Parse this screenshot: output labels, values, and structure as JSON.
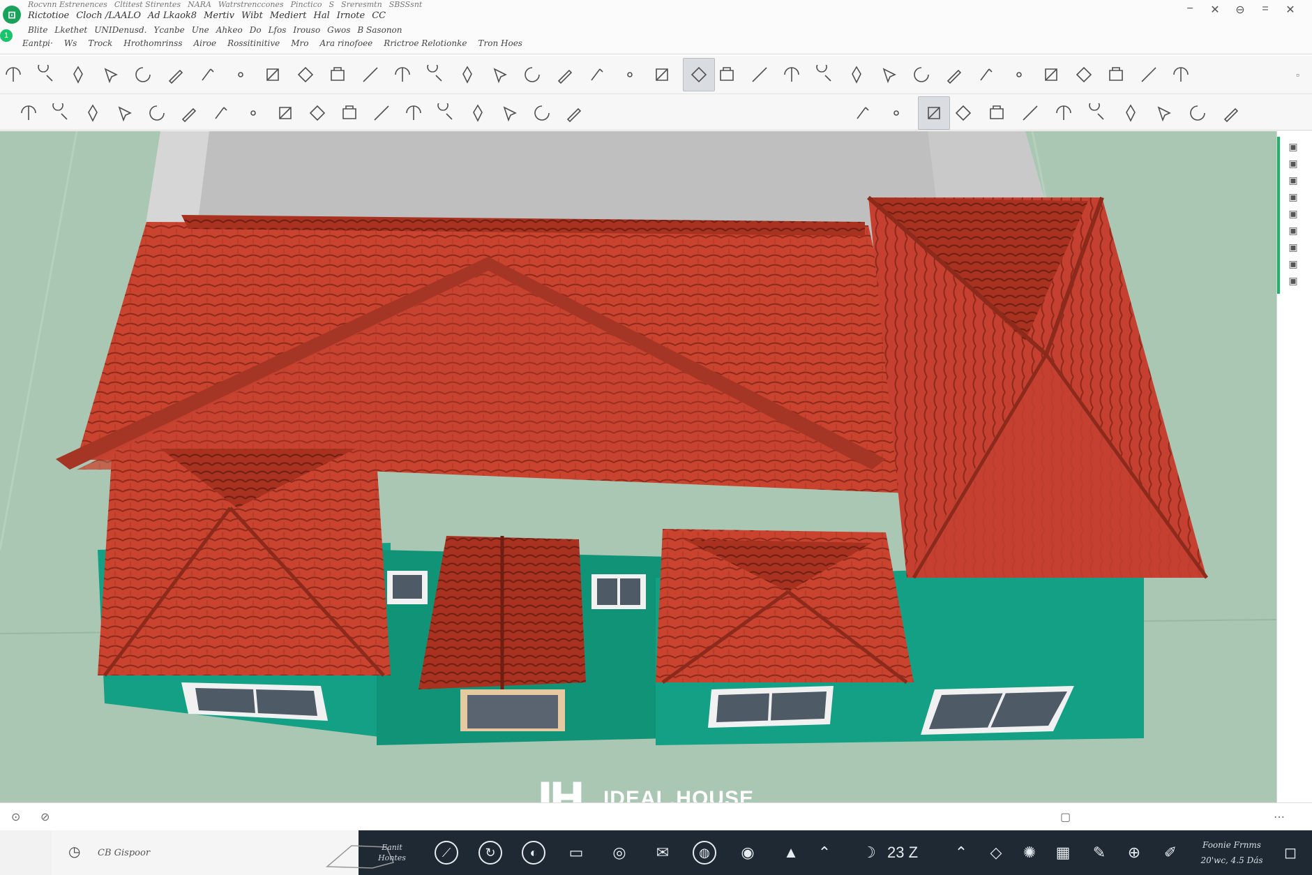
{
  "app": {
    "badge": "⊡",
    "badge2": "1"
  },
  "menus": {
    "row1": [
      "Rocvnn Estrenences",
      "Cltitest Stirentes",
      "NARA",
      "Watrstrenccones",
      "Pinctico",
      "S",
      "Sreresmtn",
      "SBSSsnt"
    ],
    "row2": [
      "Rictotioe",
      "Cloch /LAALO",
      "Ad Lkaok8",
      "Mertiv",
      "Wibt",
      "Mediert",
      "Hal",
      "Irnote",
      "CC"
    ],
    "row3": [
      "Blite",
      "Lkethet",
      "UNIDenusd.",
      "Ycanbe",
      "Une",
      "Ahkeo",
      "Do",
      "Lfos",
      "Irouso",
      "Gwos",
      "B Sasonon"
    ],
    "row4": [
      "Eantpi·",
      "Ws",
      "Trock",
      "Hrothomrinss",
      "Airoe",
      "Rossitinitive",
      "Mro",
      "Ara rinofoee",
      "Rrictroe Relotionke",
      "Tron Hoes"
    ]
  },
  "window_controls": [
    "−",
    "✕",
    "⊖",
    "=",
    "✕"
  ],
  "toolbar1": {
    "icons": [
      "pan-icon",
      "zoom-icon",
      "pen-icon",
      "pointer-icon",
      "orbit-icon",
      "pencil-icon",
      "brush-icon",
      "dot-icon",
      "push-pull-icon",
      "move-icon",
      "rectangle-icon",
      "slash-icon",
      "diamond-icon",
      "box-icon",
      "arrow-shape-icon",
      "lasso-icon",
      "stack-icon",
      "triangle-icon",
      "magnify-icon",
      "select-node-icon",
      "target-icon",
      "camera-bulb-icon",
      "search-lens-icon",
      "scissors-icon",
      "gear-icon",
      "rulers-icon",
      "tape-icon",
      "measure-icon",
      "circle-link-icon",
      "small-dot-icon",
      "cube-icon",
      "panel-icon",
      "house-icon",
      "house-group-icon",
      "printer-icon",
      "home-icon",
      "roof-icon"
    ],
    "active_index": 21,
    "end": "▫"
  },
  "toolbar2": {
    "icons": [
      "line-icon",
      "spline-icon",
      "frame-icon",
      "rect-select-icon",
      "hatch-icon",
      "circle-tool-icon",
      "component-icon",
      "hammer-icon",
      "wrench-icon",
      "saw-icon",
      "ruler-icon",
      "grid-icon",
      "knife-icon",
      "hammer-alt-icon",
      "pen-tool-icon",
      "book-icon",
      "cross-icon",
      "figure-icon",
      "tiny-dot-icon",
      "paint-bucket-icon",
      "image-cc-icon",
      "search-zoom-icon",
      "gallery-icon",
      "cut-icon",
      "component-alt-icon",
      "bottle-icon",
      "link-icon",
      "person-icon",
      "tree-icon",
      "figure-alt-icon"
    ],
    "active_index": 20
  },
  "right_strip": {
    "icons": [
      "layers-icon",
      "cone-icon",
      "layers-alt-icon",
      "face-icon",
      "shape-icon",
      "stack-alt-icon",
      "style-icon",
      "edit-icon",
      "tag-icon"
    ]
  },
  "viewport": {
    "watermark_logo": "IH",
    "watermark_text": "IDEAL.HOUSE",
    "colors": {
      "ground": "#a9c7b3",
      "roof": "#c9432f",
      "roof_dark": "#8c2a1c",
      "walls": "#14a084",
      "plinth": "#bfbfbf"
    }
  },
  "status": {
    "left_icon1": "⊙",
    "left_icon2": "⊘",
    "right_icon": "▢",
    "far_right_icon": "⋯"
  },
  "taskbar": {
    "search_text": "CB Gispoor",
    "app_label_line1": "Eanit",
    "app_label_line2": "Hontes",
    "counter": "23 Z",
    "clock_line1": "Foonie Frnms",
    "clock_line2": "20'wc, 4.5 Dás",
    "icons": [
      "ink-pen-icon",
      "spin-icon",
      "half-circle-icon",
      "folder-icon",
      "camera-icon",
      "mail-icon",
      "spiral-icon",
      "disc-icon",
      "photo-icon",
      "caret-icon",
      "moon-icon",
      "chevron-up-icon",
      "shield-icon",
      "settings-icon",
      "calendar-icon",
      "write-icon",
      "globe-icon",
      "pencil-alt-icon",
      "notification-icon"
    ]
  }
}
